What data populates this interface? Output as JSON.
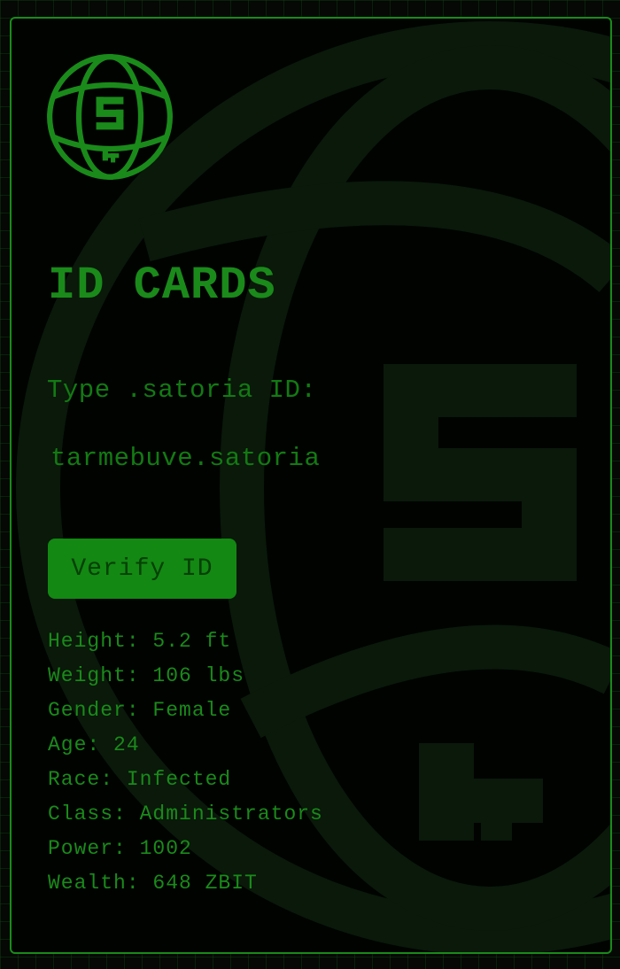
{
  "card": {
    "title": "ID CARDS",
    "prompt": "Type .satoria ID:",
    "id_input": {
      "value": "tarmebuve.satoria",
      "placeholder": ""
    },
    "verify_label": "Verify ID",
    "logo_icon": "globe-satoria-logo-icon",
    "background_icon": "globe-satoria-watermark-icon"
  },
  "stats": [
    {
      "label": "Height",
      "value": "5.2 ft",
      "text": "Height: 5.2 ft"
    },
    {
      "label": "Weight",
      "value": "106 lbs",
      "text": "Weight: 106 lbs"
    },
    {
      "label": "Gender",
      "value": "Female",
      "text": "Gender: Female"
    },
    {
      "label": "Age",
      "value": "24",
      "text": "Age: 24"
    },
    {
      "label": "Race",
      "value": "Infected",
      "text": "Race: Infected"
    },
    {
      "label": "Class",
      "value": "Administrators",
      "text": "Class: Administrators"
    },
    {
      "label": "Power",
      "value": "1002",
      "text": "Power: 1002"
    },
    {
      "label": "Wealth",
      "value": "648 ZBIT",
      "text": "Wealth: 648 ZBIT"
    }
  ],
  "colors": {
    "accent": "#1a8a1a",
    "button_bg": "#138813",
    "button_text": "#064006",
    "background": "#010301",
    "grid": "#145014"
  }
}
